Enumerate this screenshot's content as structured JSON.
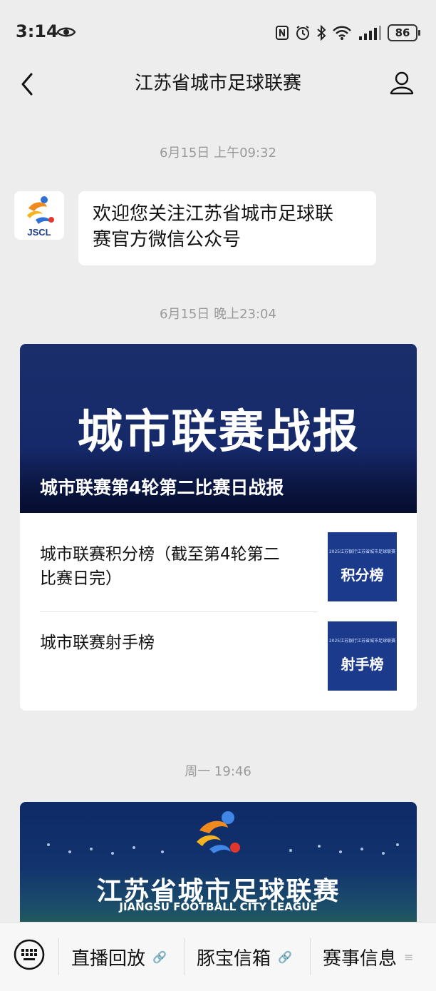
{
  "status_bar": {
    "time": "3:14",
    "battery": "86"
  },
  "nav": {
    "title": "江苏省城市足球联赛"
  },
  "messages": {
    "ts1": "6月15日 上午09:32",
    "welcome_line1": "欢迎您关注江苏省城市足球联",
    "welcome_line2": "赛官方微信公众号",
    "avatar_text": "JSCL",
    "ts2": "6月15日 晚上23:04",
    "article": {
      "cover_big": "城市联赛战报",
      "cover_title": "城市联赛第4轮第二比赛日战报",
      "items": [
        {
          "title_line1": "城市联赛积分榜（截至第4轮第二",
          "title_line2": "比赛日完）",
          "thumb_header": "2025江苏银行江苏省城市足球联赛",
          "thumb_label": "积分榜"
        },
        {
          "title_line1": "城市联赛射手榜",
          "thumb_header": "2025江苏银行江苏省城市足球联赛",
          "thumb_label": "射手榜"
        }
      ]
    },
    "ts3": "周一 19:46",
    "article2": {
      "title_cn": "江苏省城市足球联赛",
      "title_en": "JIANGSU FOOTBALL CITY LEAGUE"
    }
  },
  "bottom_menu": [
    "直播回放",
    "豚宝信箱",
    "赛事信息"
  ],
  "colors": {
    "background": "#ededed",
    "card_blue": "#16296a",
    "thumb_blue": "#1b3a8c"
  }
}
